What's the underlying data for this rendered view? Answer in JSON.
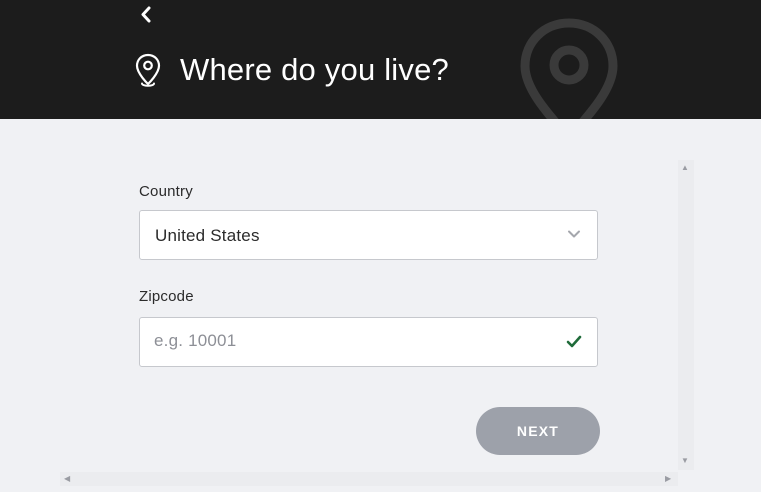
{
  "header": {
    "title": "Where do you live?",
    "back_icon": "chevron-left-icon",
    "title_icon": "map-pin-icon",
    "background_icon": "map-pin-icon"
  },
  "form": {
    "country": {
      "label": "Country",
      "selected_value": "United States",
      "icon": "chevron-down-icon"
    },
    "zipcode": {
      "label": "Zipcode",
      "value": "",
      "placeholder": "e.g. 10001",
      "status_icon": "check-icon"
    },
    "next_label": "NEXT"
  },
  "colors": {
    "header_bg": "#1c1c1c",
    "page_bg": "#f0f1f4",
    "check": "#1f6b3a",
    "button_disabled": "#9da1aa"
  }
}
